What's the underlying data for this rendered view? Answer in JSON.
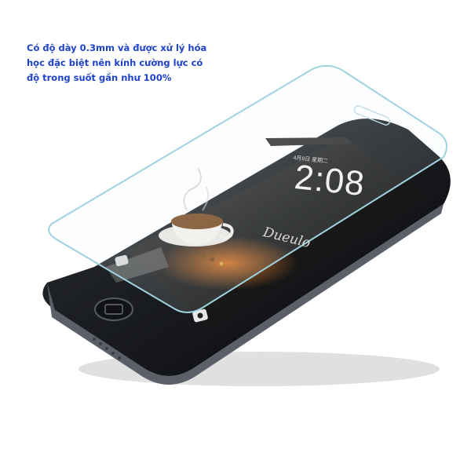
{
  "caption": {
    "lines": [
      "Có độ dày 0.3mm và được xử lý hóa",
      "học đặc biệt nên kính cường lực có",
      "độ trong suốt gần như 100%"
    ]
  },
  "phone_screen": {
    "clock": "2:08",
    "date": "4月8日 星期二",
    "brand_text": "Dueulo"
  },
  "colors": {
    "caption": "#1e43c8",
    "phone_body": "#1b1d22",
    "glass_edge": "#9fd2de"
  },
  "icons": [
    "camera-icon",
    "unlock-slider-icon",
    "home-button-icon",
    "coffee-cup-illustration"
  ]
}
